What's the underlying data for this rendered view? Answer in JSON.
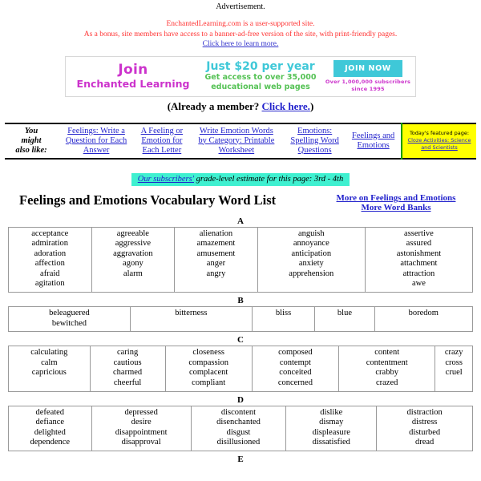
{
  "ad": {
    "label": "Advertisement."
  },
  "supporter": {
    "line1": "EnchantedLearning.com is a user-supported site.",
    "line2": "As a bonus, site members have access to a banner-ad-free version of the site, with print-friendly pages.",
    "link": "Click here to learn more."
  },
  "banner": {
    "join_big": "Join",
    "join_small": "Enchanted Learning",
    "price": "Just $20 per year",
    "sub_line1": "Get access to over 35,000",
    "sub_line2": "educational web pages",
    "cta": "JOIN NOW",
    "subs_line1": "Over 1,000,000 subscribers",
    "subs_line2": "since 1995",
    "already_prefix": "(Already a member? ",
    "already_link": "Click here.",
    "already_suffix": ")",
    "colors": {
      "magenta": "#cc33cc",
      "turquoise": "#3fc8d8",
      "green": "#55c255"
    }
  },
  "nav": {
    "label_line1": "You",
    "label_line2": "might",
    "label_line3": "also like:",
    "items": [
      {
        "line1": "Feelings: Write a",
        "line2": "Question for Each",
        "line3": "Answer"
      },
      {
        "line1": "A Feeling or",
        "line2": "Emotion for",
        "line3": "Each Letter"
      },
      {
        "line1": "Write Emotion Words",
        "line2": "by Category: Printable",
        "line3": "Worksheet"
      },
      {
        "line1": "Emotions:",
        "line2": "Spelling Word",
        "line3": "Questions"
      },
      {
        "line1": "Feelings and",
        "line2": "Emotions",
        "line3": ""
      }
    ],
    "featured": {
      "lead": "Today's featured page:",
      "link_line1": "Cloze Activities: Science",
      "link_line2": "and Scientists"
    }
  },
  "grade": {
    "link": "Our subscribers'",
    "text": " grade-level estimate for this page: 3rd - 4th",
    "bg": "#3ff0d0"
  },
  "title": {
    "heading": "Feelings and Emotions Vocabulary Word List",
    "link1": "More on Feelings and Emotions",
    "link2": "More Word Banks"
  },
  "sections": [
    {
      "letter": "A",
      "widths": [
        "17.8%",
        "17.8%",
        "17.8%",
        "23.3%",
        "23.3%"
      ],
      "columns": [
        [
          "acceptance",
          "admiration",
          "adoration",
          "affection",
          "afraid",
          "agitation"
        ],
        [
          "agreeable",
          "aggressive",
          "aggravation",
          "agony",
          "alarm"
        ],
        [
          "alienation",
          "amazement",
          "amusement",
          "anger",
          "angry"
        ],
        [
          "anguish",
          "annoyance",
          "anticipation",
          "anxiety",
          "apprehension"
        ],
        [
          "assertive",
          "assured",
          "astonishment",
          "attachment",
          "attraction",
          "awe"
        ]
      ]
    },
    {
      "letter": "B",
      "widths": [
        "26.5%",
        "26.5%",
        "13.3%",
        "12.5%",
        "21.2%"
      ],
      "columns": [
        [
          "beleaguered",
          "bewitched"
        ],
        [
          "bitterness"
        ],
        [
          "bliss"
        ],
        [
          "blue"
        ],
        [
          "boredom"
        ]
      ]
    },
    {
      "letter": "C",
      "widths": [
        "17.6%",
        "16.2%",
        "18.8%",
        "18.8%",
        "21.0%",
        "7.6%"
      ],
      "columns": [
        [
          "calculating",
          "calm",
          "capricious"
        ],
        [
          "caring",
          "cautious",
          "charmed",
          "cheerful"
        ],
        [
          "closeness",
          "compassion",
          "complacent",
          "compliant"
        ],
        [
          "composed",
          "contempt",
          "conceited",
          "concerned"
        ],
        [
          "content",
          "contentment",
          "crabby",
          "crazed"
        ],
        [
          "crazy",
          "cross",
          "cruel"
        ]
      ]
    },
    {
      "letter": "D",
      "widths": [
        "17.8%",
        "21.5%",
        "20.5%",
        "19.5%",
        "20.7%"
      ],
      "columns": [
        [
          "defeated",
          "defiance",
          "delighted",
          "dependence"
        ],
        [
          "depressed",
          "desire",
          "disappointment",
          "disapproval"
        ],
        [
          "discontent",
          "disenchanted",
          "disgust",
          "disillusioned"
        ],
        [
          "dislike",
          "dismay",
          "displeasure",
          "dissatisfied"
        ],
        [
          "distraction",
          "distress",
          "disturbed",
          "dread"
        ]
      ]
    },
    {
      "letter": "E",
      "widths": [],
      "columns": []
    }
  ]
}
